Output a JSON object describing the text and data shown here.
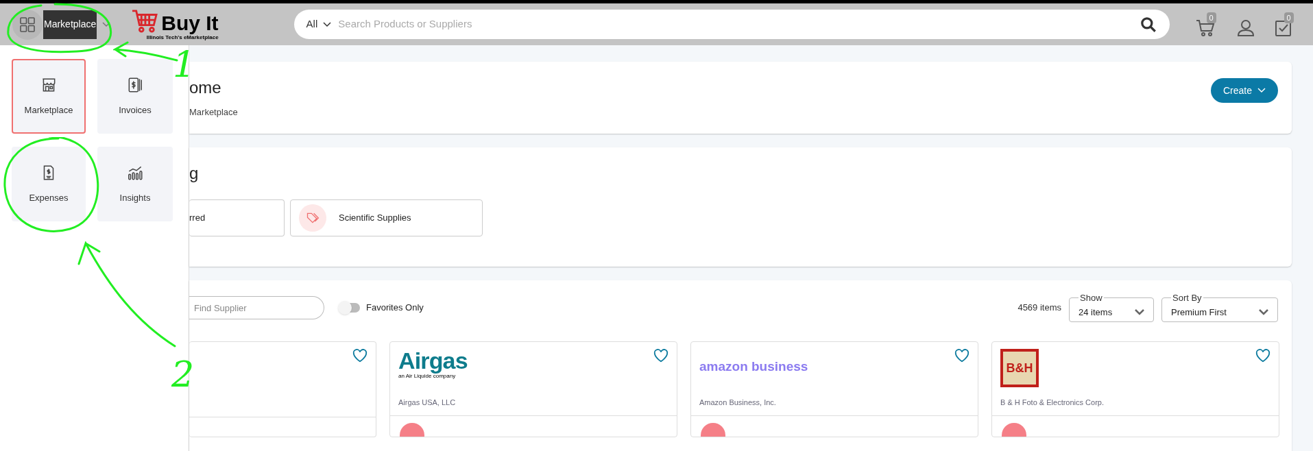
{
  "header": {
    "app_switcher": {
      "label": "Marketplace"
    },
    "logo": {
      "title": "Buy It",
      "subtitle": "Illinois Tech's eMarketplace"
    },
    "search": {
      "scope": "All",
      "placeholder": "Search Products or Suppliers"
    },
    "cart_count": "0",
    "tasks_count": "0"
  },
  "app_menu": [
    {
      "label": "Marketplace",
      "selected": true
    },
    {
      "label": "Invoices",
      "selected": false
    },
    {
      "label": "Expenses",
      "selected": false
    },
    {
      "label": "Insights",
      "selected": false
    }
  ],
  "home": {
    "title": "ome",
    "subtitle": "Marketplace",
    "create_button": "Create"
  },
  "shopping": {
    "title": "g",
    "chips": [
      {
        "label": "rred"
      },
      {
        "label": "Scientific Supplies"
      }
    ]
  },
  "suppliers": {
    "search_placeholder": "Find Supplier",
    "favorites_only": {
      "label": "Favorites Only",
      "on": false
    },
    "count": "4569 items",
    "show": {
      "label": "Show",
      "value": "24 items"
    },
    "sort": {
      "label": "Sort By",
      "value": "Premium First"
    },
    "cards": [
      {
        "logo": "Airgas",
        "logo_tagline": "an Air Liquide company",
        "name": "Airgas USA, LLC"
      },
      {
        "logo": "amazon business",
        "name": "Amazon Business, Inc."
      },
      {
        "logo": "B&H",
        "name": "B & H Foto & Electronics Corp."
      }
    ]
  },
  "annotations": [
    {
      "label": "1"
    },
    {
      "label": "2"
    }
  ]
}
